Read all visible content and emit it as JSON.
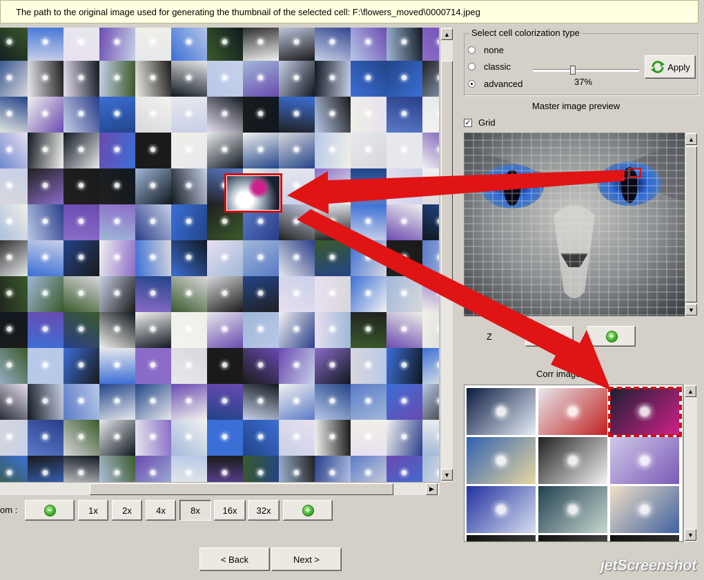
{
  "path_bar": {
    "text": "The path to the original image used for generating the thumbnail of the selected cell: F:\\flowers_moved\\0000714.jpeg"
  },
  "zoom": {
    "label": "om :",
    "buttons": [
      "1x",
      "2x",
      "4x",
      "8x",
      "16x",
      "32x"
    ],
    "selected": "8x"
  },
  "colorization": {
    "title": "Select cell colorization type",
    "options": [
      "none",
      "classic",
      "advanced"
    ],
    "selected": "advanced",
    "slider_percent": 37,
    "slider_text": "37%",
    "apply_label": "Apply"
  },
  "preview": {
    "title": "Master image preview",
    "grid_label": "Grid",
    "grid_checked": true,
    "zoom_label": "Z"
  },
  "corresponding": {
    "title": "Corr images:"
  },
  "nav": {
    "back_label": "< Back",
    "next_label": "Next >"
  },
  "watermark": {
    "text": "jetScreenshot"
  },
  "colors": {
    "highlight_red": "#e01414",
    "face_bg": "#d4d0c8",
    "path_bg": "#ffffe1"
  },
  "icons": {
    "zoom_out": "minus-circle-icon",
    "zoom_in": "plus-circle-icon",
    "apply": "refresh-arrows-icon",
    "scroll_up": "arrow-up-icon",
    "scroll_down": "arrow-down-icon",
    "scroll_left": "arrow-left-icon",
    "scroll_right": "arrow-right-icon",
    "check": "checkmark-icon"
  }
}
